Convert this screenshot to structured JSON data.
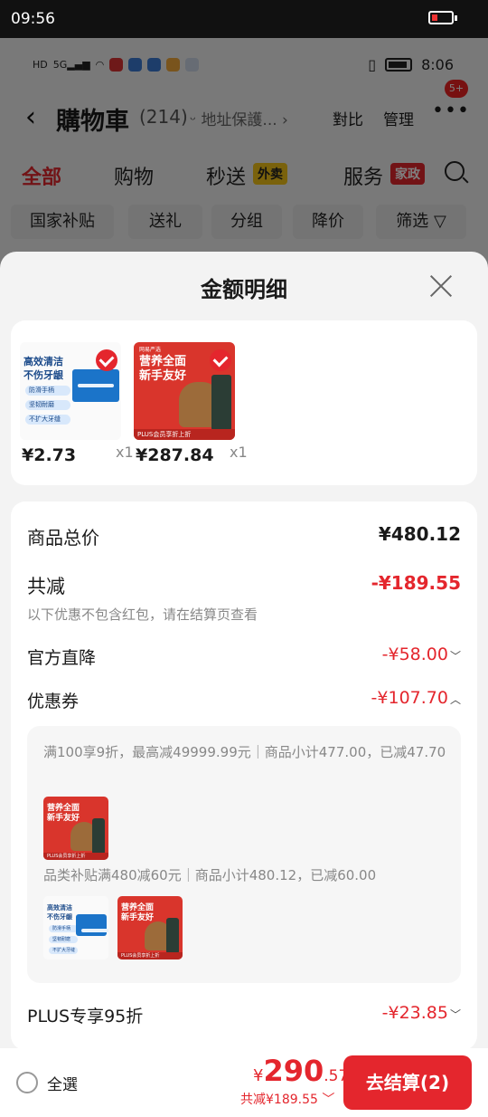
{
  "device": {
    "time": "09:56"
  },
  "inner_status": {
    "time": "8:06"
  },
  "header": {
    "title": "購物車",
    "count": "(214)",
    "address": "地址保護...",
    "compare": "對比",
    "manage": "管理",
    "badge": "5+"
  },
  "tabs": [
    {
      "label": "全部"
    },
    {
      "label": "购物"
    },
    {
      "label": "秒送",
      "tag": "外卖"
    },
    {
      "label": "服务",
      "tag": "家政"
    }
  ],
  "chips": [
    "国家补贴",
    "送礼",
    "分组",
    "降价",
    "筛选"
  ],
  "sheet": {
    "title": "金额明细",
    "products": [
      {
        "price": "¥2.73",
        "qty": "x1",
        "image": "dental-floss",
        "img_text": [
          "高效清洁",
          "不伤牙龈"
        ],
        "features": [
          "防滑手柄",
          "坚韧耐磨",
          "不扩大牙缝"
        ]
      },
      {
        "price": "¥287.84",
        "qty": "x1",
        "image": "dog-food",
        "img_text": [
          "营养全面",
          "新手友好"
        ],
        "bar_text": "PLUS会员享折上折",
        "brand": "网易严选"
      }
    ],
    "details": {
      "total_label": "商品总价",
      "total_value": "¥480.12",
      "reduce_label": "共减",
      "reduce_value": "-¥189.55",
      "reduce_note": "以下优惠不包含红包，请在结算页查看",
      "official_label": "官方直降",
      "official_value": "-¥58.00",
      "coupon_label": "优惠券",
      "coupon_value": "-¥107.70",
      "coupon_lines": [
        "满100享9折，最高减49999.99元｜商品小计477.00，已减47.70",
        "品类补贴满480减60元｜商品小计480.12，已减60.00"
      ],
      "plus_label": "PLUS专享95折",
      "plus_value": "-¥23.85"
    }
  },
  "bottom": {
    "select_all": "全選",
    "currency": "¥",
    "total_int": "290",
    "total_dec": ".57",
    "discount": "共减¥189.55",
    "checkout": "去结算(2)"
  },
  "colors": {
    "accent": "#e4262d",
    "tag_yellow": "#f5c518",
    "tag_red": "#e4262d"
  }
}
